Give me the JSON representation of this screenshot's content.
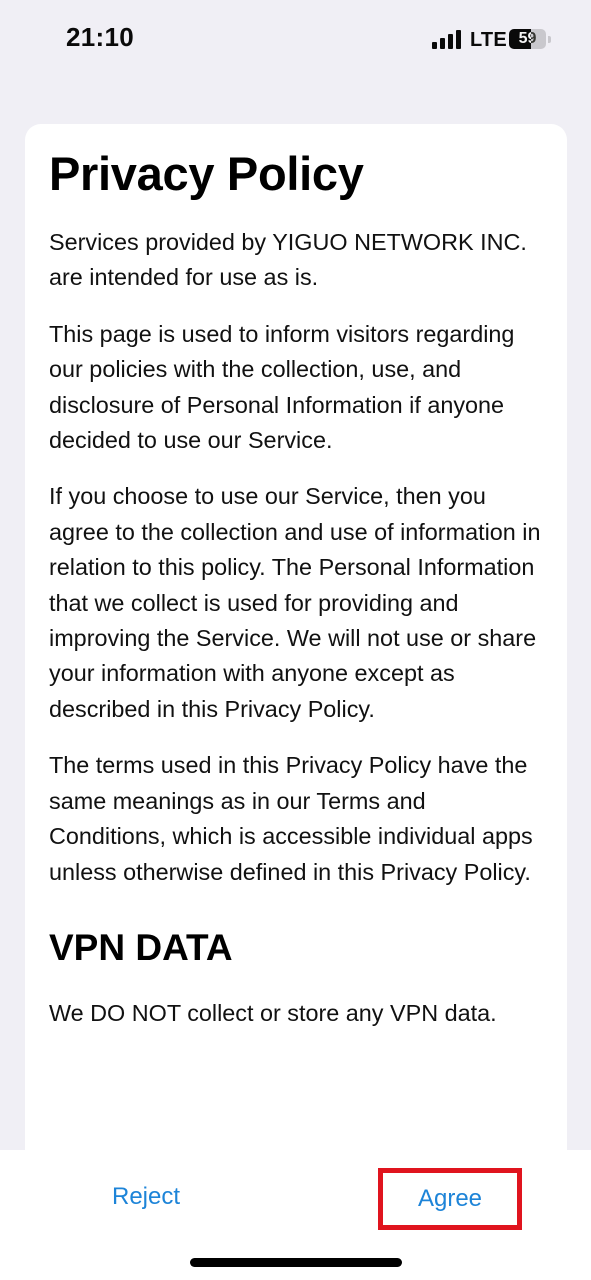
{
  "status_bar": {
    "time": "21:10",
    "network": "LTE",
    "battery_percent": "59",
    "battery_level": 0.59,
    "signal_icon": "cellular-signal-icon",
    "battery_icon": "battery-icon"
  },
  "policy": {
    "title": "Privacy Policy",
    "paragraphs": [
      "Services provided by YIGUO NETWORK INC. are intended for use as is.",
      "This page is used to inform visitors regarding our policies with the collection, use, and disclosure of Personal Information if anyone decided to use our Service.",
      "If you choose to use our Service, then you agree to the collection and use of information in relation to this policy. The Personal Information that we collect is used for providing and improving the Service. We will not use or share your information with anyone except as described in this Privacy Policy.",
      "The terms used in this Privacy Policy have the same meanings as in our Terms and Conditions, which is accessible individual apps unless otherwise defined in this Privacy Policy."
    ],
    "section_heading": "VPN DATA",
    "section_paragraph": "We DO NOT collect or store any VPN data."
  },
  "actions": {
    "reject_label": "Reject",
    "agree_label": "Agree"
  },
  "colors": {
    "accent": "#1d84d8",
    "highlight": "#e0141e",
    "background": "#f0eff5"
  }
}
